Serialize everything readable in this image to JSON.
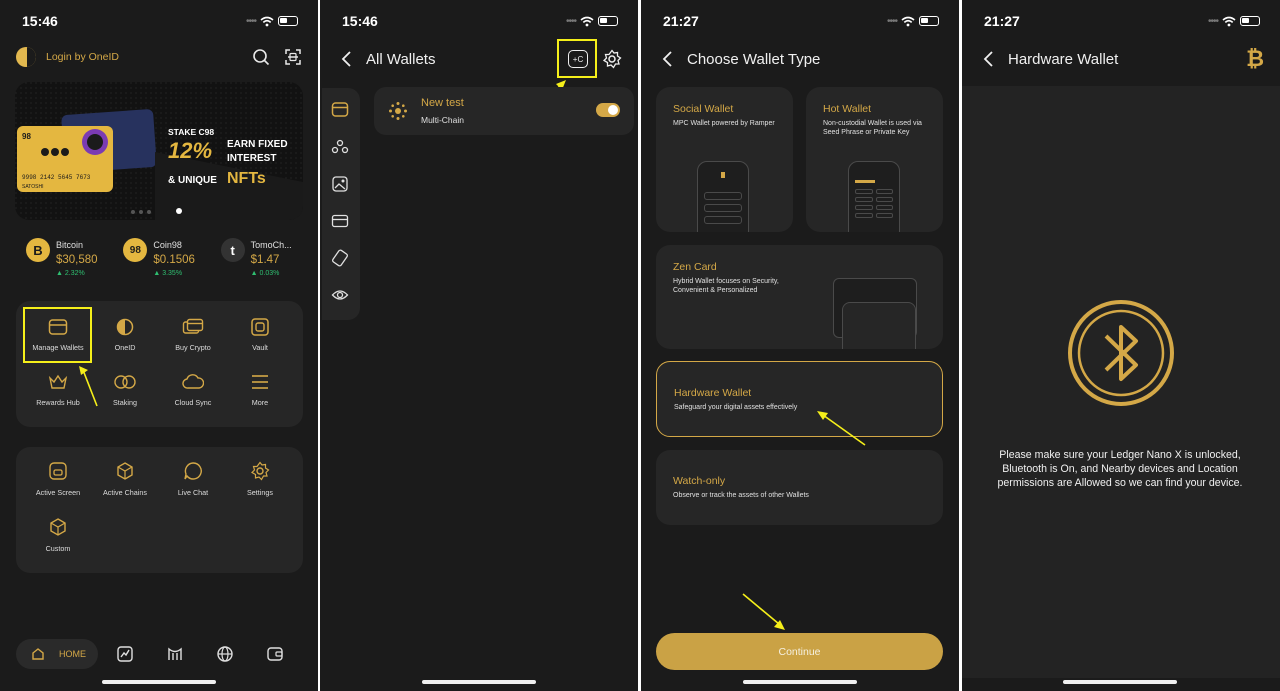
{
  "colors": {
    "accent": "#d4a847",
    "background": "#1b1b1b",
    "card": "#262626",
    "positive": "#2fbf71",
    "highlight": "#f5ef1a"
  },
  "screen1": {
    "time": "15:46",
    "login_label": "Login by OneID",
    "banner": {
      "line1": "STAKE C98",
      "big": "12%",
      "earn": "EARN FIXED",
      "interest": "INTEREST",
      "unique": "& UNIQUE",
      "nfts": "NFTs",
      "card_brand": "98",
      "card_number": "9998 2142 5645 7673",
      "card_name": "SATOSHI"
    },
    "coins": [
      {
        "name": "Bitcoin",
        "price": "$30,580",
        "change": "▲ 2.32%",
        "icon": "B"
      },
      {
        "name": "Coin98",
        "price": "$0.1506",
        "change": "▲ 3.35%",
        "icon": "98"
      },
      {
        "name": "TomoCh...",
        "price": "$1.47",
        "change": "▲ 0.03%",
        "icon": "t"
      }
    ],
    "menu1": [
      "Manage Wallets",
      "OneID",
      "Buy Crypto",
      "Vault",
      "Rewards Hub",
      "Staking",
      "Cloud Sync",
      "More"
    ],
    "menu2": [
      "Active Screen",
      "Active Chains",
      "Live Chat",
      "Settings",
      "Custom"
    ],
    "nav": {
      "home": "HOME"
    }
  },
  "screen2": {
    "time": "15:46",
    "title": "All Wallets",
    "add_icon_text": "+C",
    "wallet": {
      "name": "New test",
      "type": "Multi-Chain"
    }
  },
  "screen3": {
    "time": "21:27",
    "title": "Choose Wallet Type",
    "types": [
      {
        "title": "Social Wallet",
        "desc": "MPC Wallet powered by Ramper"
      },
      {
        "title": "Hot Wallet",
        "desc": "Non-custodial Wallet is used via Seed Phrase or Private Key"
      },
      {
        "title": "Zen Card",
        "desc": "Hybrid Wallet focuses on Security, Convenient & Personalized"
      },
      {
        "title": "Hardware Wallet",
        "desc": "Safeguard your digital assets effectively"
      },
      {
        "title": "Watch-only",
        "desc": "Observe or track the assets of other Wallets"
      }
    ],
    "continue_label": "Continue"
  },
  "screen4": {
    "time": "21:27",
    "title": "Hardware Wallet",
    "message": "Please make sure your Ledger Nano X is unlocked, Bluetooth is On, and Nearby devices and Location permissions are Allowed so we can find your device."
  }
}
